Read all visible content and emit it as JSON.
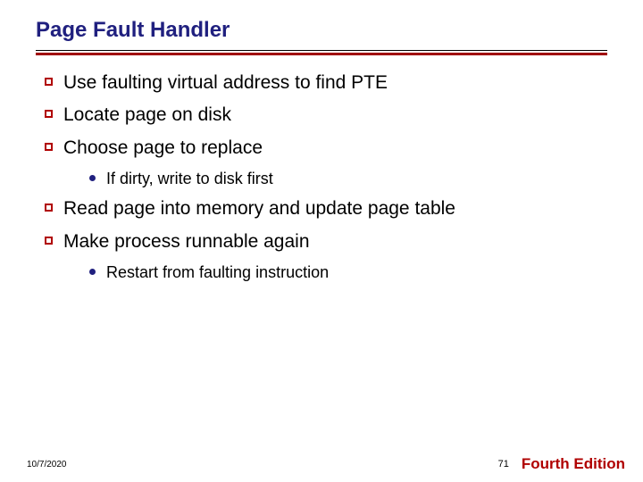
{
  "title": "Page Fault Handler",
  "bullets": {
    "b1": "Use faulting virtual address to find PTE",
    "b2": "Locate page on disk",
    "b3": "Choose page to replace",
    "b3a": "If dirty, write to disk first",
    "b4": "Read page into memory and update page table",
    "b5": "Make process runnable again",
    "b5a": "Restart from faulting instruction"
  },
  "footer": {
    "date": "10/7/2020",
    "page": "71",
    "edition": "Fourth Edition"
  }
}
